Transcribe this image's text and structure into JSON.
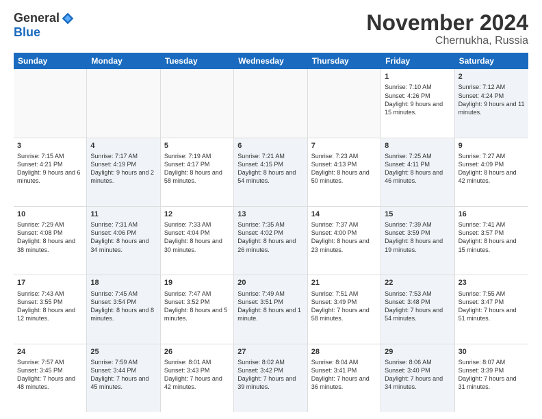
{
  "logo": {
    "general": "General",
    "blue": "Blue"
  },
  "title": "November 2024",
  "location": "Chernukha, Russia",
  "header_days": [
    "Sunday",
    "Monday",
    "Tuesday",
    "Wednesday",
    "Thursday",
    "Friday",
    "Saturday"
  ],
  "rows": [
    [
      {
        "day": "",
        "info": "",
        "empty": true
      },
      {
        "day": "",
        "info": "",
        "empty": true
      },
      {
        "day": "",
        "info": "",
        "empty": true
      },
      {
        "day": "",
        "info": "",
        "empty": true
      },
      {
        "day": "",
        "info": "",
        "empty": true
      },
      {
        "day": "1",
        "info": "Sunrise: 7:10 AM\nSunset: 4:26 PM\nDaylight: 9 hours and 15 minutes.",
        "empty": false
      },
      {
        "day": "2",
        "info": "Sunrise: 7:12 AM\nSunset: 4:24 PM\nDaylight: 9 hours and 11 minutes.",
        "empty": false,
        "shade": true
      }
    ],
    [
      {
        "day": "3",
        "info": "Sunrise: 7:15 AM\nSunset: 4:21 PM\nDaylight: 9 hours and 6 minutes.",
        "empty": false
      },
      {
        "day": "4",
        "info": "Sunrise: 7:17 AM\nSunset: 4:19 PM\nDaylight: 9 hours and 2 minutes.",
        "empty": false,
        "shade": true
      },
      {
        "day": "5",
        "info": "Sunrise: 7:19 AM\nSunset: 4:17 PM\nDaylight: 8 hours and 58 minutes.",
        "empty": false
      },
      {
        "day": "6",
        "info": "Sunrise: 7:21 AM\nSunset: 4:15 PM\nDaylight: 8 hours and 54 minutes.",
        "empty": false,
        "shade": true
      },
      {
        "day": "7",
        "info": "Sunrise: 7:23 AM\nSunset: 4:13 PM\nDaylight: 8 hours and 50 minutes.",
        "empty": false
      },
      {
        "day": "8",
        "info": "Sunrise: 7:25 AM\nSunset: 4:11 PM\nDaylight: 8 hours and 46 minutes.",
        "empty": false,
        "shade": true
      },
      {
        "day": "9",
        "info": "Sunrise: 7:27 AM\nSunset: 4:09 PM\nDaylight: 8 hours and 42 minutes.",
        "empty": false
      }
    ],
    [
      {
        "day": "10",
        "info": "Sunrise: 7:29 AM\nSunset: 4:08 PM\nDaylight: 8 hours and 38 minutes.",
        "empty": false
      },
      {
        "day": "11",
        "info": "Sunrise: 7:31 AM\nSunset: 4:06 PM\nDaylight: 8 hours and 34 minutes.",
        "empty": false,
        "shade": true
      },
      {
        "day": "12",
        "info": "Sunrise: 7:33 AM\nSunset: 4:04 PM\nDaylight: 8 hours and 30 minutes.",
        "empty": false
      },
      {
        "day": "13",
        "info": "Sunrise: 7:35 AM\nSunset: 4:02 PM\nDaylight: 8 hours and 26 minutes.",
        "empty": false,
        "shade": true
      },
      {
        "day": "14",
        "info": "Sunrise: 7:37 AM\nSunset: 4:00 PM\nDaylight: 8 hours and 23 minutes.",
        "empty": false
      },
      {
        "day": "15",
        "info": "Sunrise: 7:39 AM\nSunset: 3:59 PM\nDaylight: 8 hours and 19 minutes.",
        "empty": false,
        "shade": true
      },
      {
        "day": "16",
        "info": "Sunrise: 7:41 AM\nSunset: 3:57 PM\nDaylight: 8 hours and 15 minutes.",
        "empty": false
      }
    ],
    [
      {
        "day": "17",
        "info": "Sunrise: 7:43 AM\nSunset: 3:55 PM\nDaylight: 8 hours and 12 minutes.",
        "empty": false
      },
      {
        "day": "18",
        "info": "Sunrise: 7:45 AM\nSunset: 3:54 PM\nDaylight: 8 hours and 8 minutes.",
        "empty": false,
        "shade": true
      },
      {
        "day": "19",
        "info": "Sunrise: 7:47 AM\nSunset: 3:52 PM\nDaylight: 8 hours and 5 minutes.",
        "empty": false
      },
      {
        "day": "20",
        "info": "Sunrise: 7:49 AM\nSunset: 3:51 PM\nDaylight: 8 hours and 1 minute.",
        "empty": false,
        "shade": true
      },
      {
        "day": "21",
        "info": "Sunrise: 7:51 AM\nSunset: 3:49 PM\nDaylight: 7 hours and 58 minutes.",
        "empty": false
      },
      {
        "day": "22",
        "info": "Sunrise: 7:53 AM\nSunset: 3:48 PM\nDaylight: 7 hours and 54 minutes.",
        "empty": false,
        "shade": true
      },
      {
        "day": "23",
        "info": "Sunrise: 7:55 AM\nSunset: 3:47 PM\nDaylight: 7 hours and 51 minutes.",
        "empty": false
      }
    ],
    [
      {
        "day": "24",
        "info": "Sunrise: 7:57 AM\nSunset: 3:45 PM\nDaylight: 7 hours and 48 minutes.",
        "empty": false
      },
      {
        "day": "25",
        "info": "Sunrise: 7:59 AM\nSunset: 3:44 PM\nDaylight: 7 hours and 45 minutes.",
        "empty": false,
        "shade": true
      },
      {
        "day": "26",
        "info": "Sunrise: 8:01 AM\nSunset: 3:43 PM\nDaylight: 7 hours and 42 minutes.",
        "empty": false
      },
      {
        "day": "27",
        "info": "Sunrise: 8:02 AM\nSunset: 3:42 PM\nDaylight: 7 hours and 39 minutes.",
        "empty": false,
        "shade": true
      },
      {
        "day": "28",
        "info": "Sunrise: 8:04 AM\nSunset: 3:41 PM\nDaylight: 7 hours and 36 minutes.",
        "empty": false
      },
      {
        "day": "29",
        "info": "Sunrise: 8:06 AM\nSunset: 3:40 PM\nDaylight: 7 hours and 34 minutes.",
        "empty": false,
        "shade": true
      },
      {
        "day": "30",
        "info": "Sunrise: 8:07 AM\nSunset: 3:39 PM\nDaylight: 7 hours and 31 minutes.",
        "empty": false
      }
    ]
  ]
}
